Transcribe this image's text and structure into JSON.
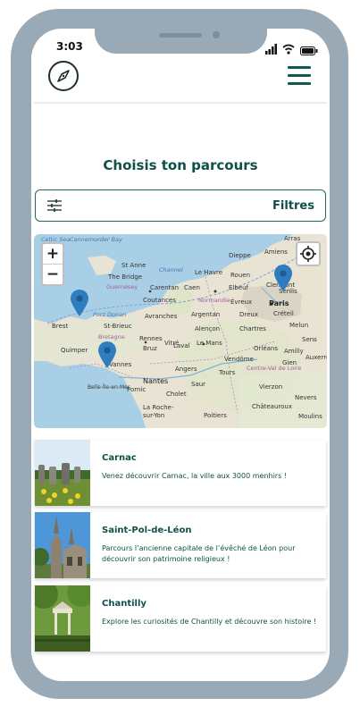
{
  "status_bar": {
    "time": "3:03"
  },
  "header": {
    "compass_icon": "compass-icon",
    "menu_icon": "hamburger-icon"
  },
  "page": {
    "title": "Choisis ton parcours"
  },
  "filters": {
    "label": "Filtres",
    "icon": "sliders-icon"
  },
  "map": {
    "zoom_in": "+",
    "zoom_out": "−",
    "locate_icon": "crosshair-icon",
    "labels": {
      "celtic_sea": "Celtic Sea",
      "cannes_bay": "Cannemorder Bay",
      "channel": "Channel",
      "st_anne": "St Anne",
      "the_bridge": "The Bridge",
      "guernesey": "Guernesey",
      "dieppe": "Dieppe",
      "arras": "Arras",
      "amiens": "Amiens",
      "le_havre": "Le Havre",
      "rouen": "Rouen",
      "caen": "Caen",
      "carentan": "Carentan",
      "elbeuf": "Elbeuf",
      "clermont": "Clermont",
      "senlis": "Senlis",
      "coutances": "Coutances",
      "normandie": "Normandie",
      "evreux": "Évreux",
      "paris": "Paris",
      "creteil": "Créteil",
      "porz_donan": "Porz Donan",
      "avranches": "Avranches",
      "argentan": "Argentan",
      "dreux": "Dreux",
      "melun": "Melun",
      "brest": "Brest",
      "st_brieuc": "St-Brieuc",
      "alencon": "Alençon",
      "chartres": "Chartres",
      "bretagne": "Bretagne",
      "rennes": "Rennes",
      "vitre": "Vitré",
      "laval": "Laval",
      "le_mans": "Le Mans",
      "orleans": "Orléans",
      "sens": "Sens",
      "quimper": "Quimper",
      "bruz": "Bruz",
      "amilly": "Amilly",
      "vannes": "Vannes",
      "angers": "Angers",
      "tours": "Tours",
      "centre_val": "Centre-Val de Loire",
      "gien": "Gien",
      "auxerre": "Auxerre",
      "belle_ile": "Belle-Île-en-Mer",
      "pornic": "Pornic",
      "nantes": "Nantes",
      "saur": "Saur",
      "vendome": "Vendôme",
      "vierzon": "Vierzon",
      "cholet": "Cholet",
      "nevers": "Nevers",
      "la_roche": "La Roche-sur-Yon",
      "poitiers": "Poitiers",
      "chateauroux": "Châteauroux",
      "moulins": "Moulins"
    }
  },
  "parcours": [
    {
      "title": "Carnac",
      "description": "Venez découvrir Carnac, la ville aux 3000 menhirs !"
    },
    {
      "title": "Saint-Pol-de-Léon",
      "description": "Parcours l’ancienne capitale de l’évêché de Léon pour découvrir son patrimoine religieux !"
    },
    {
      "title": "Chantilly",
      "description": "Explore les curiosités de Chantilly et découvre son histoire !"
    }
  ],
  "colors": {
    "primary": "#0f5048",
    "frame": "#9aa9b6",
    "marker": "#2f7dbf"
  }
}
